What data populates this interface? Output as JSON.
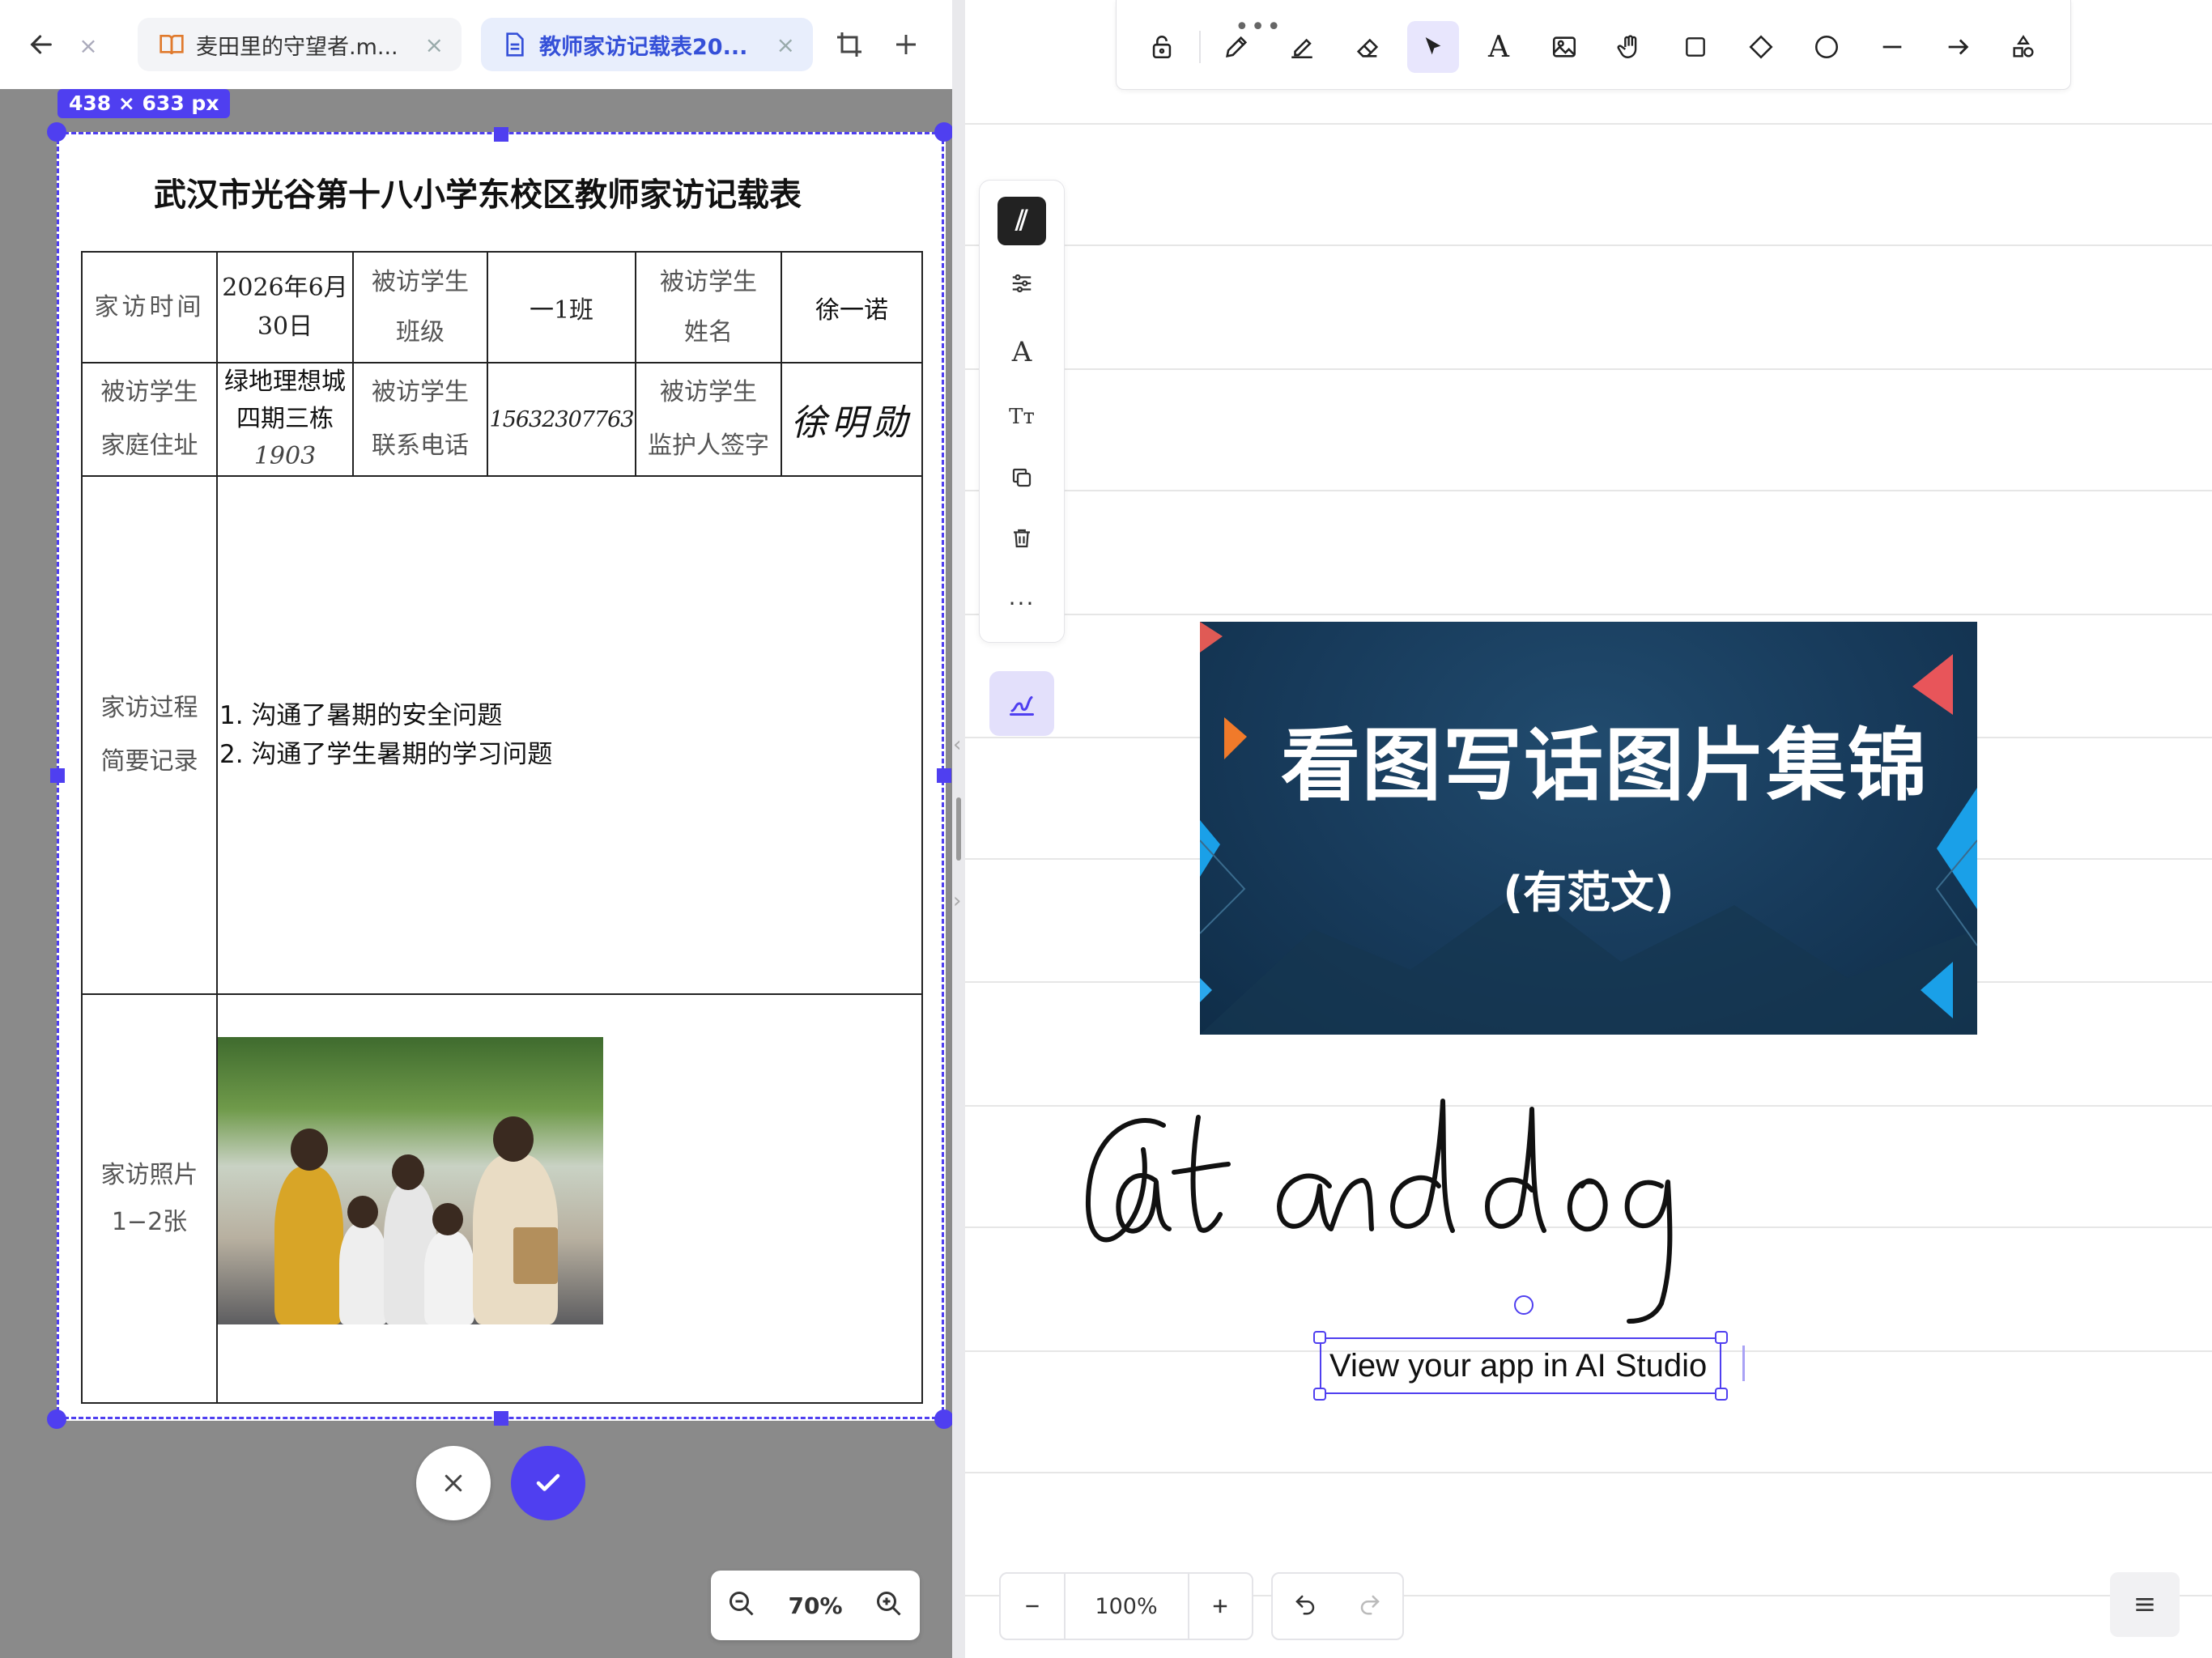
{
  "tabs": [
    {
      "title": "麦田里的守望者.m...",
      "icon": "book-icon",
      "active": false
    },
    {
      "title": "教师家访记载表20...",
      "icon": "document-icon",
      "active": true
    }
  ],
  "crop": {
    "size_label": "438 × 633 px",
    "zoom_label": "70%"
  },
  "document": {
    "title": "武汉市光谷第十八小学东校区教师家访记载表",
    "labels": {
      "visit_time": "家访时间",
      "student_class_1": "被访学生",
      "student_class_2": "班级",
      "student_name_1": "被访学生",
      "student_name_2": "姓名",
      "address_1": "被访学生",
      "address_2": "家庭住址",
      "phone_1": "被访学生",
      "phone_2": "联系电话",
      "guardian_1": "被访学生",
      "guardian_2": "监护人签字",
      "process_1": "家访过程",
      "process_2": "简要记录",
      "photo_1": "家访照片",
      "photo_2": "1−2张"
    },
    "values": {
      "visit_time_1": "2026年6月",
      "visit_time_2": "30日",
      "class": "一1班",
      "name": "徐一诺",
      "address_1": "绿地理想城",
      "address_2": "四期三栋",
      "address_3": "1903",
      "phone": "15632307763",
      "signature": "徐明勋"
    },
    "notes": [
      "1. 沟通了暑期的安全问题",
      "2. 沟通了学生暑期的学习问题"
    ]
  },
  "canvas": {
    "banner_title": "看图写话图片集锦",
    "banner_subtitle": "(有范文)",
    "handwriting": "Cat and dog",
    "textbox": "View your app in AI Studio",
    "zoom_label": "100%"
  },
  "toolbar_tools": [
    "lock-icon",
    "pen-icon",
    "highlighter-icon",
    "eraser-icon",
    "pointer-icon",
    "text-icon",
    "image-icon",
    "hand-icon",
    "rectangle-icon",
    "diamond-icon",
    "circle-icon",
    "line-icon",
    "arrow-icon",
    "shapes-icon"
  ],
  "colors": {
    "accent": "#4f3ff0",
    "banner_bg": "#173a5a"
  }
}
